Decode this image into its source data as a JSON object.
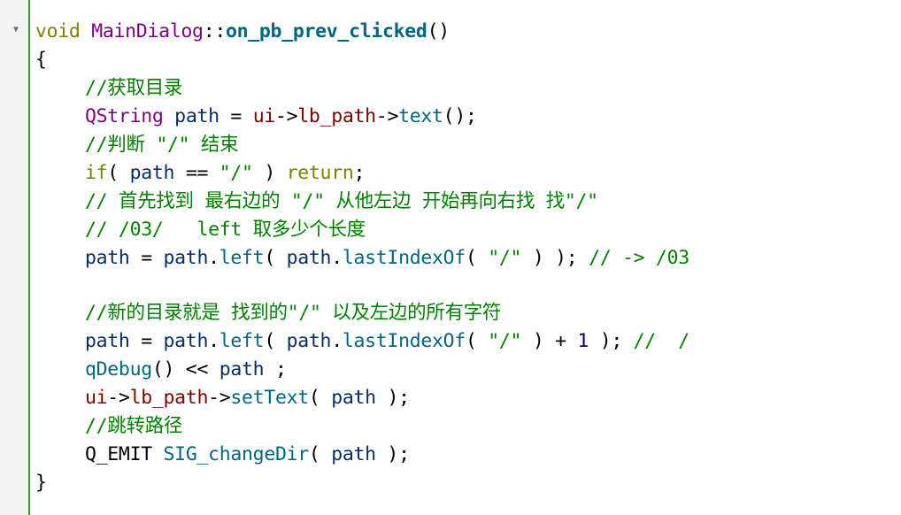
{
  "colors": {
    "keyword": "#808000",
    "class": "#800080",
    "function": "#00677c",
    "variable": "#092e64",
    "string": "#008000",
    "comment": "#008000",
    "number": "#000080",
    "member": "#800000",
    "gutter_border": "#3f8f3f"
  },
  "gutter": {
    "fold_icon": "chevron-down-icon",
    "fold_glyph": "▼"
  },
  "code": {
    "l1": {
      "void": "void",
      "space": " ",
      "cls": "MainDialog",
      "scope": "::",
      "fn": "on_pb_prev_clicked",
      "parens": "()"
    },
    "l2": {
      "brace": "{"
    },
    "l3": {
      "comment": "//获取目录"
    },
    "l4": {
      "type": "QString",
      "sp1": " ",
      "var": "path",
      "op": " = ",
      "ui": "ui",
      "arrow1": "->",
      "member": "lb_path",
      "arrow2": "->",
      "fn": "text",
      "end": "();"
    },
    "l5": {
      "comment": "//判断 \"/\" 结束"
    },
    "l6": {
      "if": "if",
      "p1": "( ",
      "var": "path",
      "op": " == ",
      "str": "\"/\"",
      "p2": " ) ",
      "ret": "return",
      "semi": ";"
    },
    "l7": {
      "comment": "// 首先找到 最右边的 \"/\" 从他左边 开始再向右找 找\"/\""
    },
    "l8": {
      "comment": "// /03/   left 取多少个长度"
    },
    "l9": {
      "v1": "path",
      "op": " = ",
      "v2": "path",
      "dot1": ".",
      "f1": "left",
      "p1": "( ",
      "v3": "path",
      "dot2": ".",
      "f2": "lastIndexOf",
      "p2": "( ",
      "str": "\"/\"",
      "end": " ) ); ",
      "comment": "// -> /03"
    },
    "l10": {
      "comment": "//新的目录就是 找到的\"/\" 以及左边的所有字符"
    },
    "l11": {
      "v1": "path",
      "op": " = ",
      "v2": "path",
      "dot1": ".",
      "f1": "left",
      "p1": "( ",
      "v3": "path",
      "dot2": ".",
      "f2": "lastIndexOf",
      "p2": "( ",
      "str": "\"/\"",
      "plus": " ) + ",
      "num": "1",
      "end": " ); ",
      "comment": "//  /"
    },
    "l12": {
      "fn": "qDebug",
      "mid": "() << ",
      "var": "path",
      "end": " ;"
    },
    "l13": {
      "ui": "ui",
      "arrow": "->",
      "member": "lb_path",
      "arrow2": "->",
      "fn": "setText",
      "p1": "( ",
      "var": "path",
      "end": " );"
    },
    "l14": {
      "comment": "//跳转路径"
    },
    "l15": {
      "macro": "Q_EMIT",
      "sp": " ",
      "fn": "SIG_changeDir",
      "p1": "( ",
      "var": "path",
      "end": " );"
    },
    "l16": {
      "brace": "}"
    }
  }
}
